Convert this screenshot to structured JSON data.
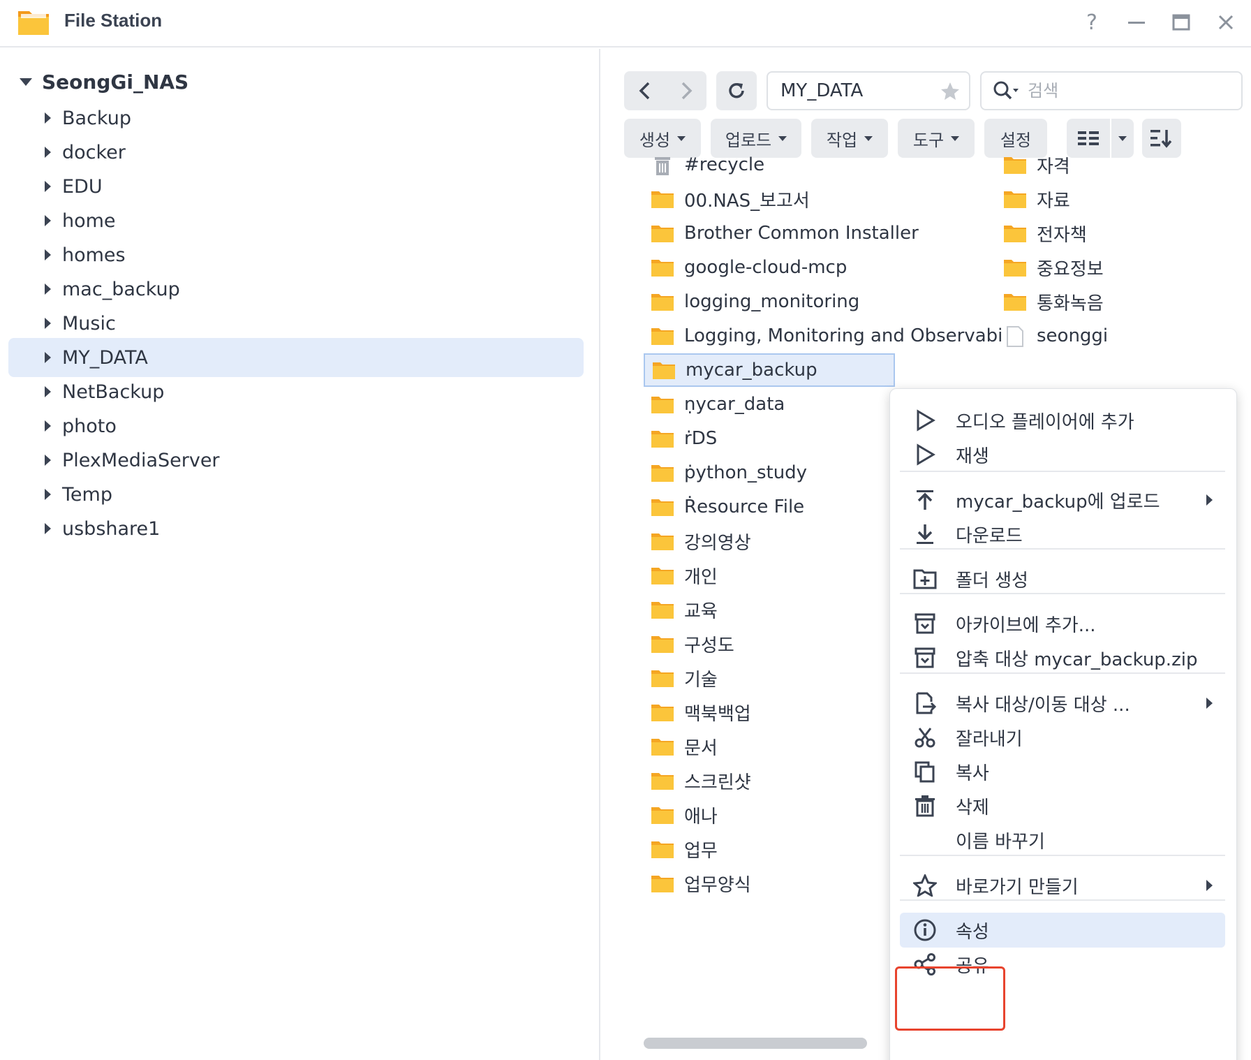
{
  "window": {
    "title": "File Station",
    "help_glyph": "?",
    "minimize_glyph": "—",
    "close_glyph": "✕"
  },
  "tree": {
    "root": "SeongGi_NAS",
    "items": [
      {
        "label": "Backup",
        "selected": false
      },
      {
        "label": "docker",
        "selected": false
      },
      {
        "label": "EDU",
        "selected": false
      },
      {
        "label": "home",
        "selected": false
      },
      {
        "label": "homes",
        "selected": false
      },
      {
        "label": "mac_backup",
        "selected": false
      },
      {
        "label": "Music",
        "selected": false
      },
      {
        "label": "MY_DATA",
        "selected": true
      },
      {
        "label": "NetBackup",
        "selected": false
      },
      {
        "label": "photo",
        "selected": false
      },
      {
        "label": "PlexMediaServer",
        "selected": false
      },
      {
        "label": "Temp",
        "selected": false
      },
      {
        "label": "usbshare1",
        "selected": false
      }
    ]
  },
  "toolbar": {
    "path": "MY_DATA",
    "search_placeholder": "검색",
    "create": "생성",
    "upload": "업로드",
    "action": "작업",
    "tools": "도구",
    "settings": "설정"
  },
  "files": {
    "col1": [
      {
        "name": "#recycle",
        "icon": "trash-icon"
      },
      {
        "name": "00.NAS_보고서",
        "icon": "folder-icon"
      },
      {
        "name": "Brother Common Installer",
        "icon": "folder-icon"
      },
      {
        "name": "google-cloud-mcp",
        "icon": "folder-icon"
      },
      {
        "name": "logging_monitoring",
        "icon": "folder-icon"
      },
      {
        "name": "Logging, Monitoring and Observabi",
        "icon": "folder-icon"
      },
      {
        "name": "mycar_backup",
        "icon": "folder-icon",
        "selected": true
      },
      {
        "name": "ṇycar_data",
        "icon": "folder-icon"
      },
      {
        "name": "ṙDS",
        "icon": "folder-icon"
      },
      {
        "name": "ṗython_study",
        "icon": "folder-icon"
      },
      {
        "name": "Ṙesource File",
        "icon": "folder-icon"
      },
      {
        "name": "강의영상",
        "icon": "folder-icon"
      },
      {
        "name": "개인",
        "icon": "folder-icon"
      },
      {
        "name": "교육",
        "icon": "folder-icon"
      },
      {
        "name": "구성도",
        "icon": "folder-icon"
      },
      {
        "name": "기술",
        "icon": "folder-icon"
      },
      {
        "name": "맥북백업",
        "icon": "folder-icon"
      },
      {
        "name": "문서",
        "icon": "folder-icon"
      },
      {
        "name": "스크린샷",
        "icon": "folder-icon"
      },
      {
        "name": "애나",
        "icon": "folder-icon"
      },
      {
        "name": "업무",
        "icon": "folder-icon"
      },
      {
        "name": "업무양식",
        "icon": "folder-icon"
      }
    ],
    "col2": [
      {
        "name": "자격",
        "icon": "folder-icon"
      },
      {
        "name": "자료",
        "icon": "folder-icon"
      },
      {
        "name": "전자책",
        "icon": "folder-icon"
      },
      {
        "name": "중요정보",
        "icon": "folder-icon"
      },
      {
        "name": "통화녹음",
        "icon": "folder-icon"
      },
      {
        "name": "seonggi",
        "icon": "file-icon"
      }
    ]
  },
  "context_menu": {
    "items": [
      {
        "label": "오디오 플레이어에 추가",
        "icon": "play-icon"
      },
      {
        "label": "재생",
        "icon": "play-icon"
      },
      {
        "label": "mycar_backup에 업로드",
        "icon": "upload-icon",
        "submenu": true
      },
      {
        "label": "다운로드",
        "icon": "download-icon"
      },
      {
        "label": "폴더 생성",
        "icon": "new-folder-icon"
      },
      {
        "label": "아카이브에 추가...",
        "icon": "archive-icon"
      },
      {
        "label": "압축 대상 mycar_backup.zip",
        "icon": "archive-icon"
      },
      {
        "label": "복사 대상/이동 대상 ...",
        "icon": "copy-move-icon",
        "submenu": true
      },
      {
        "label": "잘라내기",
        "icon": "scissors-icon"
      },
      {
        "label": "복사",
        "icon": "copy-icon"
      },
      {
        "label": "삭제",
        "icon": "trash-icon"
      },
      {
        "label": "이름 바꾸기",
        "icon": ""
      },
      {
        "label": "바로가기 만들기",
        "icon": "star-icon",
        "submenu": true
      },
      {
        "label": "속성",
        "icon": "info-icon",
        "highlighted": true
      },
      {
        "label": "공유",
        "icon": "share-icon"
      }
    ]
  },
  "colors": {
    "folder": "#fbc53b",
    "selection": "#e3ecfa",
    "highlight_box": "#e8442e"
  }
}
